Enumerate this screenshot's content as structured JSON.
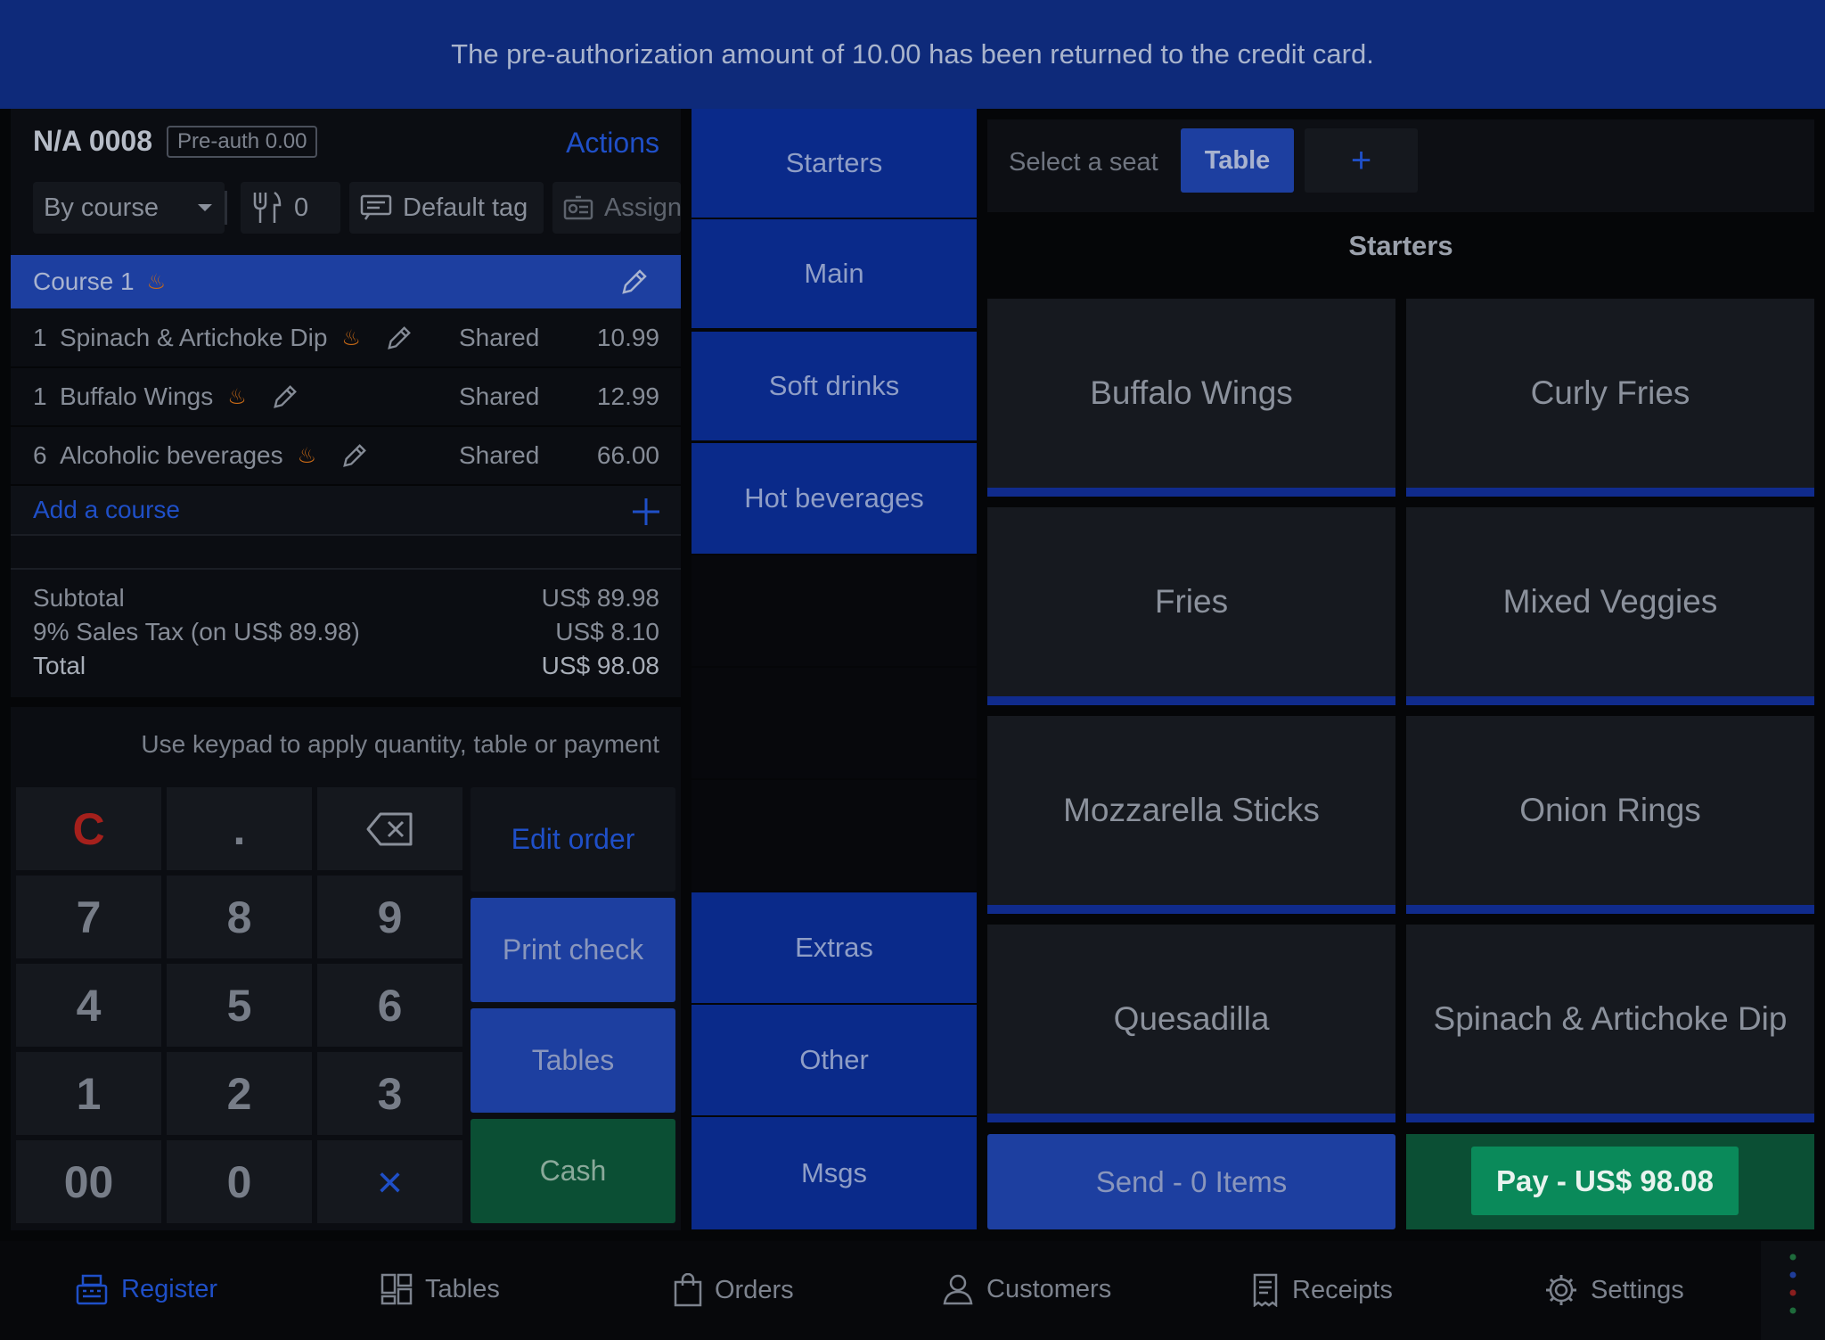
{
  "banner": {
    "message": "The pre-authorization amount of 10.00 has been returned to the credit card."
  },
  "order": {
    "id": "N/A 0008",
    "preauth": "Pre-auth 0.00",
    "actions_label": "Actions",
    "group_by": "By course",
    "guests": "0",
    "default_tag": "Default tag",
    "assign": "Assign",
    "course": {
      "label": "Course 1"
    },
    "items": [
      {
        "qty": "1",
        "name": "Spinach & Artichoke Dip",
        "seat": "Shared",
        "price": "10.99"
      },
      {
        "qty": "1",
        "name": "Buffalo Wings",
        "seat": "Shared",
        "price": "12.99"
      },
      {
        "qty": "6",
        "name": "Alcoholic beverages",
        "seat": "Shared",
        "price": "66.00"
      }
    ],
    "add_course": "Add a course",
    "subtotal_label": "Subtotal",
    "subtotal": "US$ 89.98",
    "tax_label": "9% Sales Tax (on US$ 89.98)",
    "tax": "US$ 8.10",
    "total_label": "Total",
    "total": "US$ 98.08"
  },
  "keypad": {
    "hint": "Use keypad to apply quantity, table or payment",
    "clear": "C",
    "dot": ".",
    "keys": [
      "7",
      "8",
      "9",
      "4",
      "5",
      "6",
      "1",
      "2",
      "3",
      "00",
      "0"
    ],
    "multiply": "×",
    "edit_order": "Edit order",
    "print_check": "Print check",
    "tables": "Tables",
    "cash": "Cash"
  },
  "categories": {
    "top": [
      "Starters",
      "Main",
      "Soft drinks",
      "Hot beverages"
    ],
    "bottom": [
      "Extras",
      "Other",
      "Msgs"
    ]
  },
  "seat_bar": {
    "label": "Select a seat",
    "table": "Table",
    "add": "+"
  },
  "menu": {
    "title": "Starters",
    "items": [
      "Buffalo Wings",
      "Curly Fries",
      "Fries",
      "Mixed Veggies",
      "Mozzarella Sticks",
      "Onion Rings",
      "Quesadilla",
      "Spinach & Artichoke Dip"
    ]
  },
  "footer_actions": {
    "send": "Send - 0 Items",
    "pay": "Pay - US$ 98.08"
  },
  "nav": [
    "Register",
    "Tables",
    "Orders",
    "Customers",
    "Receipts",
    "Settings"
  ],
  "colors": {
    "accent": "#1f4fc7",
    "banner": "#0e2a7a",
    "category": "#0a2a8a",
    "cash": "#0b4f34",
    "pay": "#0a8a5a"
  }
}
